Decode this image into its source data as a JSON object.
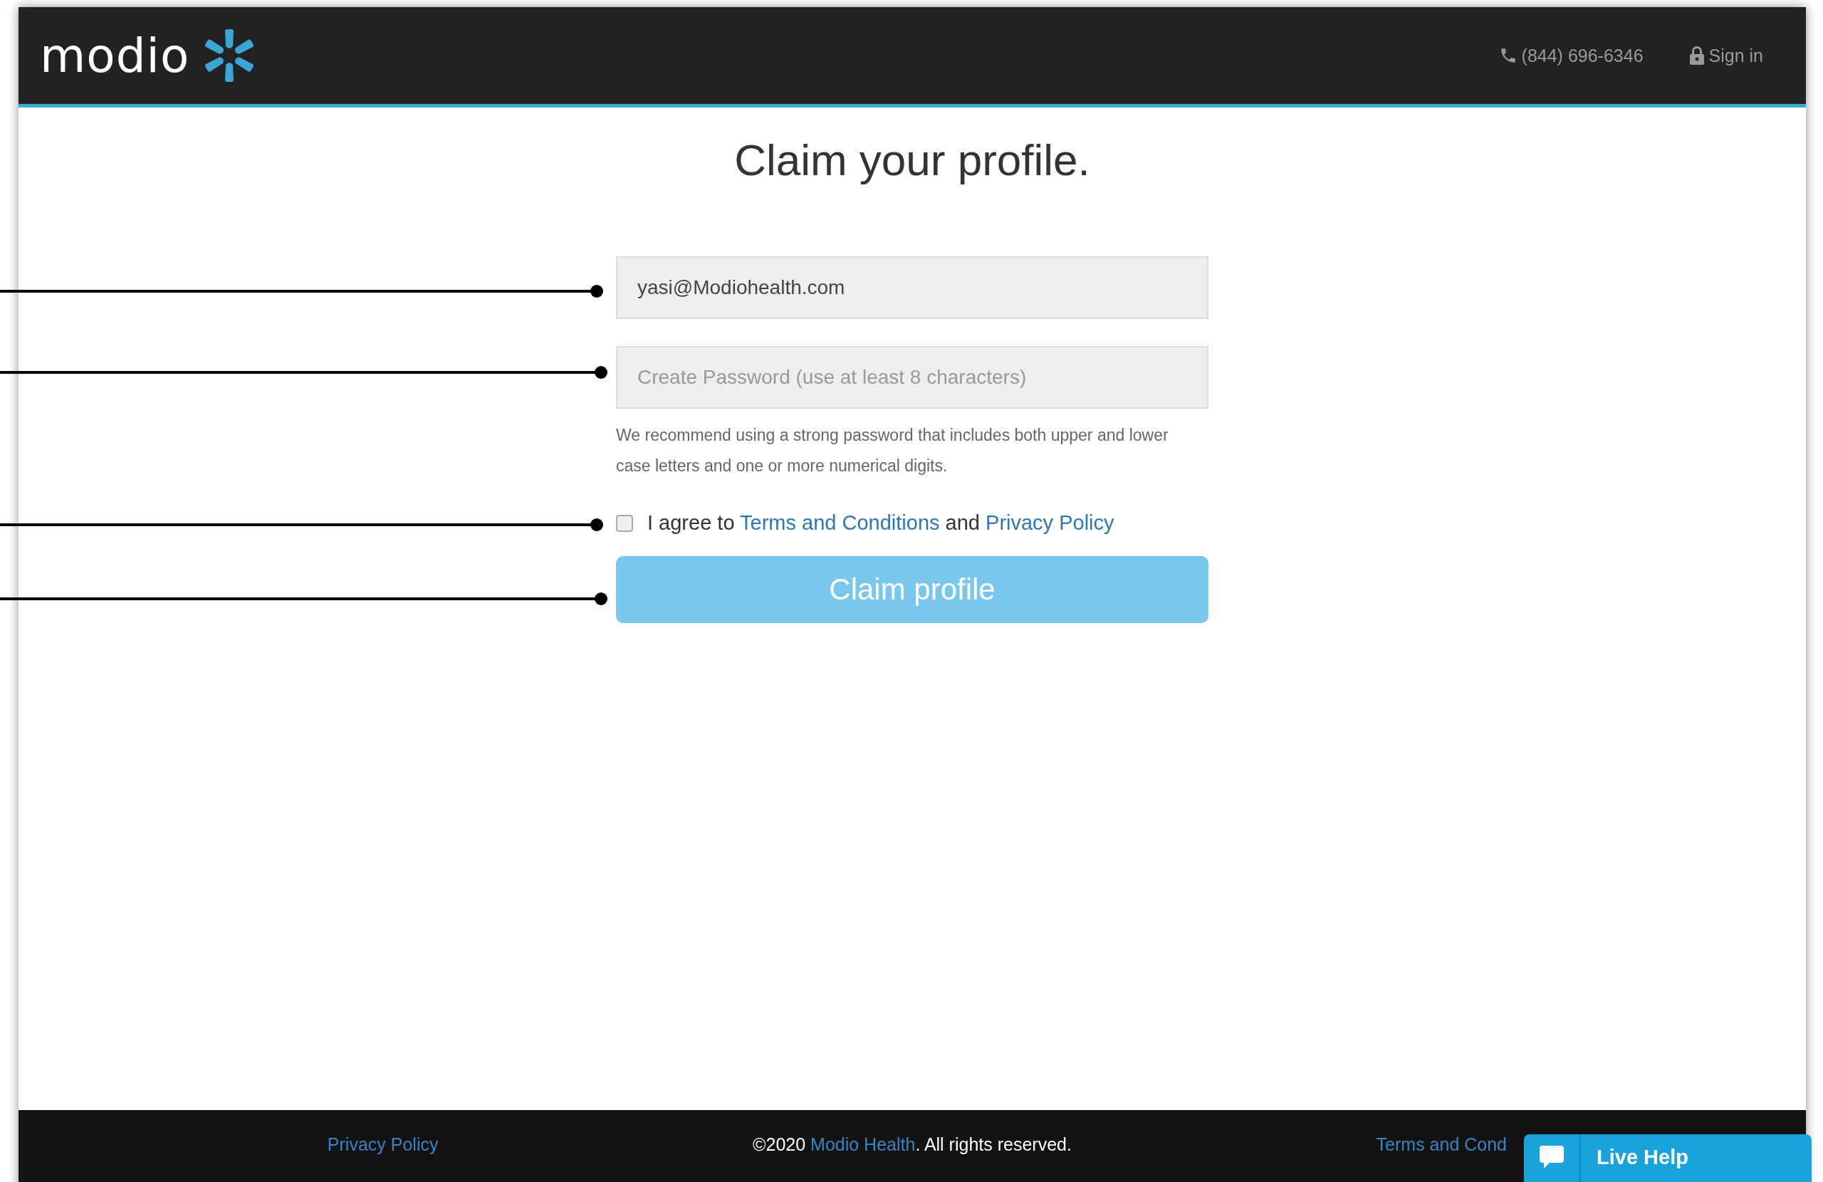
{
  "header": {
    "logo": "modio",
    "phone": "(844) 696-6346",
    "sign_in": "Sign in"
  },
  "title": "Claim your profile.",
  "email_field": {
    "value": "yasi@Modiohealth.com"
  },
  "password_field": {
    "placeholder": "Create Password (use at least 8 characters)"
  },
  "password_hint": "We recommend using a strong password that includes both upper and lower case letters and one or more numerical digits.",
  "agreement": {
    "checked": false,
    "parts": [
      {
        "kind": "text",
        "text": "I agree to "
      },
      {
        "kind": "link",
        "text": "Terms and Conditions"
      },
      {
        "kind": "text",
        "text": " and "
      },
      {
        "kind": "link",
        "text": "Privacy Policy"
      }
    ]
  },
  "submit_button": {
    "label": "Claim profile"
  },
  "footer": {
    "privacy_link": "Privacy Policy",
    "copyright": [
      {
        "kind": "text",
        "text": "©2020 "
      },
      {
        "kind": "link",
        "text": "Modio Health"
      },
      {
        "kind": "text",
        "text": ". All rights reserved."
      }
    ],
    "terms_link": "Terms and Cond"
  },
  "live_help": {
    "label": "Live Help"
  }
}
